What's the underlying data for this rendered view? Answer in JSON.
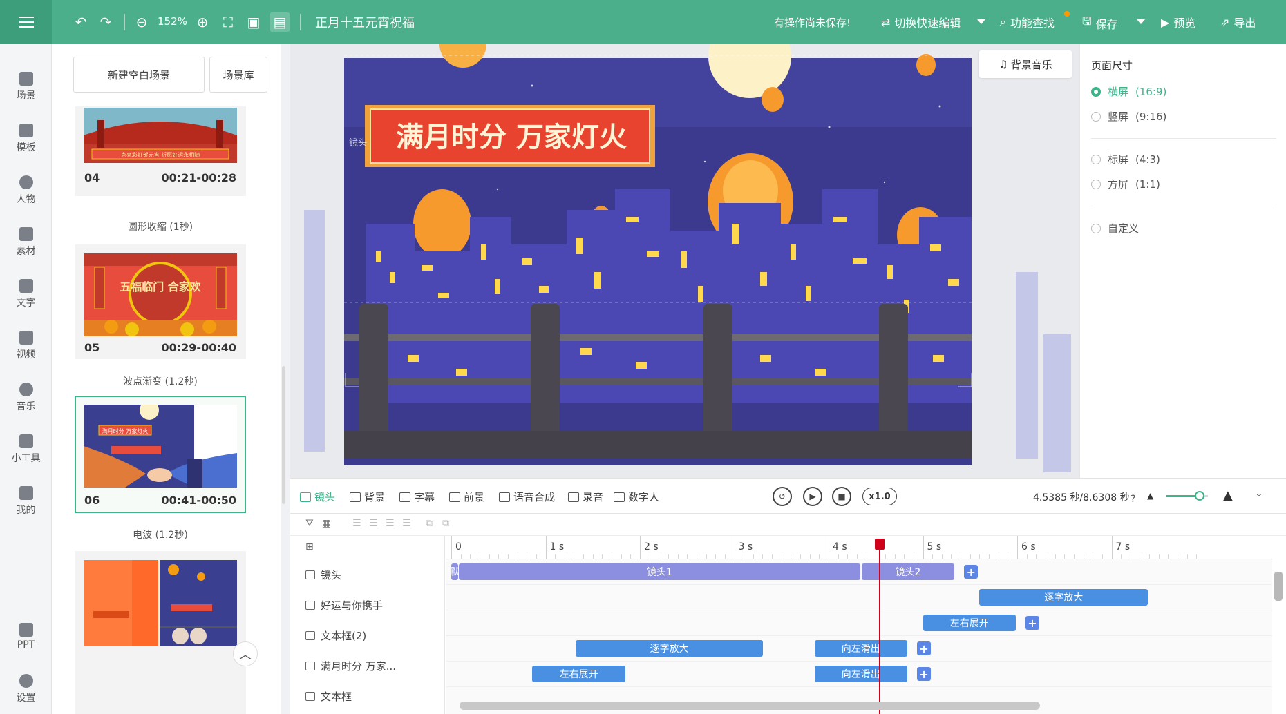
{
  "app": {
    "document_title": "正月十五元宵祝福",
    "unsaved_notice": "有操作尚未保存!",
    "zoom_level": "152%"
  },
  "toolbar": {
    "quick_edit_label": "切换快速编辑",
    "find_label": "功能查找",
    "save_label": "保存",
    "preview_label": "预览",
    "export_label": "导出"
  },
  "rail": {
    "items": [
      {
        "label": "场景",
        "icon": "scene-icon"
      },
      {
        "label": "模板",
        "icon": "template-icon"
      },
      {
        "label": "人物",
        "icon": "person-icon"
      },
      {
        "label": "素材",
        "icon": "material-icon"
      },
      {
        "label": "文字",
        "icon": "text-icon"
      },
      {
        "label": "视频",
        "icon": "video-icon"
      },
      {
        "label": "音乐",
        "icon": "music-icon"
      },
      {
        "label": "小工具",
        "icon": "tools-icon"
      },
      {
        "label": "我的",
        "icon": "upload-icon"
      },
      {
        "label": "PPT",
        "icon": "ppt-icon"
      },
      {
        "label": "设置",
        "icon": "gear-icon"
      }
    ]
  },
  "scene_panel": {
    "new_scene_label": "新建空白场景",
    "library_label": "场景库",
    "scenes": [
      {
        "number": "04",
        "time": "00:21-00:28",
        "transition": "圆形收缩 (1秒)",
        "thumb_caption": "点亮彩灯贺元宵 祈愿好运永相随"
      },
      {
        "number": "05",
        "time": "00:29-00:40",
        "transition": "波点渐变 (1.2秒)",
        "thumb_caption": "五福临门 合家欢"
      },
      {
        "number": "06",
        "time": "00:41-00:50",
        "transition": "电波 (1.2秒)",
        "thumb_caption": "满月时分 万家灯火"
      },
      {
        "number": "07",
        "time": "",
        "transition": "",
        "thumb_caption": ""
      }
    ]
  },
  "canvas": {
    "banner_text": "满月时分 万家灯火",
    "lens_tag": "镜头",
    "bgm_label": "背景音乐"
  },
  "page_size": {
    "title": "页面尺寸",
    "options": [
      {
        "label": "横屏",
        "ratio": "(16:9)",
        "selected": true
      },
      {
        "label": "竖屏",
        "ratio": "(9:16)",
        "selected": false
      },
      {
        "label": "标屏",
        "ratio": "(4:3)",
        "selected": false
      },
      {
        "label": "方屏",
        "ratio": "(1:1)",
        "selected": false
      },
      {
        "label": "自定义",
        "ratio": "",
        "selected": false
      }
    ]
  },
  "timeline": {
    "tabs": [
      {
        "label": "镜头",
        "active": true
      },
      {
        "label": "背景",
        "active": false
      },
      {
        "label": "字幕",
        "active": false
      },
      {
        "label": "前景",
        "active": false
      },
      {
        "label": "语音合成",
        "active": false
      },
      {
        "label": "录音",
        "active": false
      },
      {
        "label": "数字人",
        "active": false
      }
    ],
    "speed": "x1.0",
    "time_readout": "4.5385 秒/8.6308 秒",
    "playhead_seconds": 4.5385,
    "zoom_fraction": 0.8,
    "ruler_ticks": [
      "0",
      "1 s",
      "2 s",
      "3 s",
      "4 s",
      "5 s",
      "6 s",
      "7 s"
    ],
    "tracks": [
      {
        "label": "镜头",
        "clips": [
          {
            "label": "默",
            "start": 0,
            "end": 0.08
          },
          {
            "label": "镜头1",
            "start": 0.08,
            "end": 4.35
          },
          {
            "label": "镜头2",
            "start": 4.35,
            "end": 5.35
          }
        ]
      },
      {
        "label": "好运与你携手",
        "clips": [
          {
            "label": "逐字放大",
            "start": 5.6,
            "end": 7.4
          }
        ]
      },
      {
        "label": "文本框(2)",
        "clips": [
          {
            "label": "左右展开",
            "start": 5.0,
            "end": 6.0
          }
        ]
      },
      {
        "label": "满月时分 万家...",
        "clips": [
          {
            "label": "逐字放大",
            "start": 1.32,
            "end": 3.32
          },
          {
            "label": "向左滑出",
            "start": 3.85,
            "end": 4.85
          }
        ]
      },
      {
        "label": "文本框",
        "clips": [
          {
            "label": "左右展开",
            "start": 0.86,
            "end": 1.86
          },
          {
            "label": "向左滑出",
            "start": 3.85,
            "end": 4.85
          }
        ]
      }
    ]
  },
  "colors": {
    "brand": "#4caf8c",
    "accent": "#3eb489",
    "lens_clip": "#8c8fe0",
    "anim_clip": "#4a90e2",
    "playhead": "#d0021b"
  }
}
